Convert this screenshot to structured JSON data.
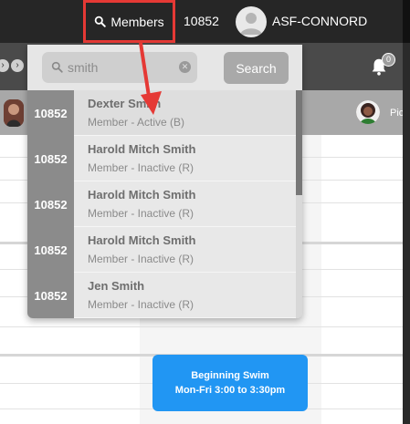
{
  "topbar": {
    "members_label": "Members",
    "member_count": "10852",
    "user_name": "ASF-CONNORD"
  },
  "toolbar": {
    "notification_count": "0"
  },
  "subbar": {
    "right_label": "Pic"
  },
  "search": {
    "value": "smith",
    "button_label": "Search"
  },
  "results": [
    {
      "id": "10852",
      "name": "Dexter Smith",
      "status": "Member - Active (B)"
    },
    {
      "id": "10852",
      "name": "Harold Mitch Smith",
      "status": "Member - Inactive (R)"
    },
    {
      "id": "10852",
      "name": "Harold Mitch Smith",
      "status": "Member - Inactive (R)"
    },
    {
      "id": "10852",
      "name": "Harold Mitch Smith",
      "status": "Member - Inactive (R)"
    },
    {
      "id": "10852",
      "name": "Jen Smith",
      "status": "Member - Inactive (R)"
    }
  ],
  "class_card": {
    "title": "Beginning Swim",
    "time": "Mon-Fri 3:00 to 3:30pm"
  },
  "colors": {
    "highlight": "#e53935",
    "card": "#2196f3",
    "topbar": "#262626"
  }
}
